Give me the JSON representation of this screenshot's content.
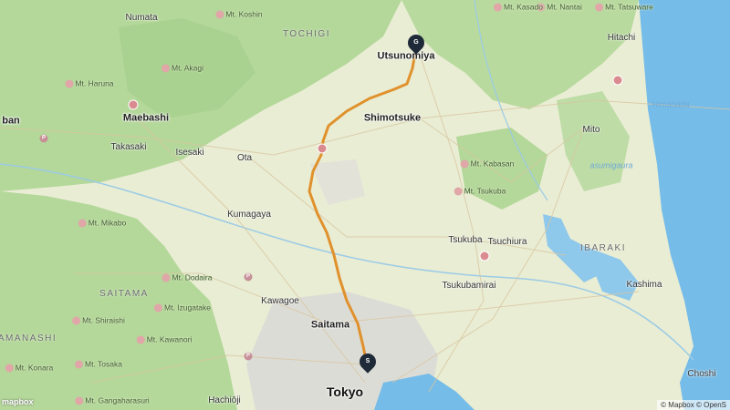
{
  "map": {
    "colors": {
      "forest": "#b4d79a",
      "land": "#e9edd4",
      "urban": "#dcdcd6",
      "water": "#75bce8",
      "route": "#e0912c",
      "pin": "#1e2a38"
    },
    "markers": {
      "start": {
        "label": "S",
        "name": "Tokyo",
        "icon": "start-pin-icon"
      },
      "goal": {
        "label": "G",
        "name": "Utsunomiya",
        "icon": "goal-pin-icon"
      }
    },
    "labels": {
      "cities": {
        "utsunomiya": "Utsunomiya",
        "shimotsuke": "Shimotsuke",
        "maebashi": "Maebashi",
        "saitama": "Saitama",
        "tokyo": "Tokyo",
        "takasaki": "Takasaki",
        "isesaki": "Isesaki",
        "ota": "Ota",
        "kumagaya": "Kumagaya",
        "kawagoe": "Kawagoe",
        "tsukuba": "Tsukuba",
        "tsuchiura": "Tsuchiura",
        "tsukubamirai": "Tsukubamirai",
        "mito": "Mito",
        "hitachi": "Hitachi",
        "kashima": "Kashima",
        "choshi": "Choshi",
        "numata": "Numata",
        "hachioji": "Hachiōji",
        "edge_left": "ban"
      },
      "mountains": {
        "koshin": "Mt. Koshin",
        "akagi": "Mt. Akagi",
        "haruna": "Mt. Haruna",
        "mikabo": "Mt. Mikabo",
        "dodaira": "Mt. Dodaira",
        "izugatake": "Mt. Izugatake",
        "shiraishi": "Mt. Shiraishi",
        "kawanori": "Mt. Kawanori",
        "konara": "Mt. Konara",
        "tosaka": "Mt. Tosaka",
        "gangaharasuri": "Mt. Gangaharasuri",
        "kabasan": "Mt. Kabasan",
        "tsukuba": "Mt. Tsukuba",
        "nantai": "Mt. Nantai",
        "tatsuware": "Mt. Tatsuware",
        "top": "Mt. Kasado"
      },
      "prefectures": {
        "tochigi": "TOCHIGI",
        "ibaraki": "IBARAKI",
        "saitama": "SAITAMA",
        "yamanashi": "AMANASHI"
      },
      "water": {
        "himanada": "Himanada",
        "kasumigaura": "asumigaura"
      }
    },
    "attribution": "© Mapbox © OpenS",
    "logo": "mapbox"
  }
}
